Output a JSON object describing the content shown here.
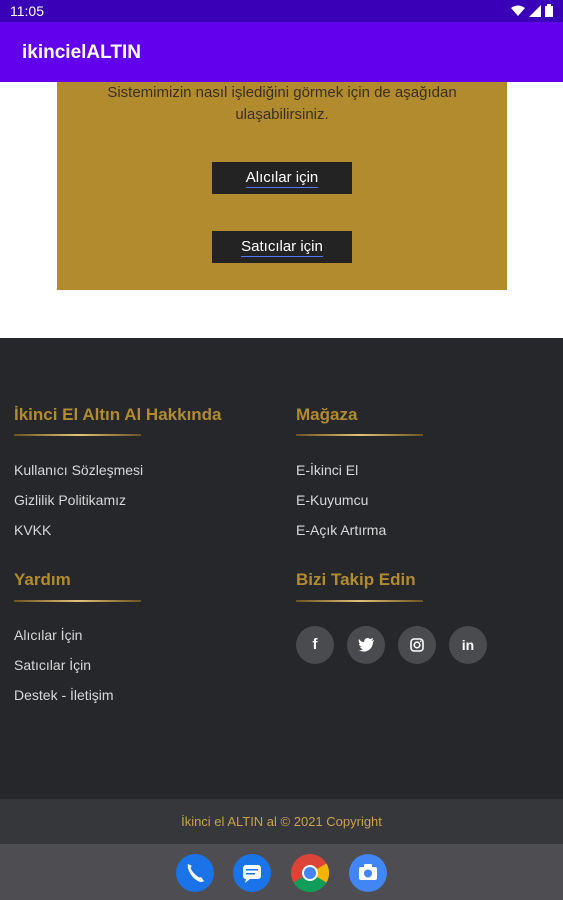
{
  "status_bar": {
    "time": "11:05"
  },
  "app_bar": {
    "title": "ikincielALTIN"
  },
  "hero": {
    "description": "Sistemimizin nasıl işlediğini görmek için de aşağıdan ulaşabilirsiniz.",
    "buyers_button": "Alıcılar için",
    "sellers_button": "Satıcılar için"
  },
  "footer": {
    "about": {
      "title": "İkinci El Altın Al Hakkında",
      "links": [
        "Kullanıcı Sözleşmesi",
        "Gizlilik Politikamız",
        "KVKK"
      ]
    },
    "store": {
      "title": "Mağaza",
      "links": [
        "E-İkinci El",
        "E-Kuyumcu",
        "E-Açık Artırma"
      ]
    },
    "help": {
      "title": "Yardım",
      "links": [
        "Alıcılar İçin",
        "Satıcılar İçin",
        "Destek - İletişim"
      ]
    },
    "follow": {
      "title": "Bizi Takip Edin",
      "icons": [
        "facebook-icon",
        "twitter-icon",
        "instagram-icon",
        "linkedin-icon"
      ]
    },
    "copyright": "İkinci el ALTIN al © 2021 Copyright"
  },
  "colors": {
    "gold": "#b38b2f",
    "dark": "#26272b",
    "purple": "#6200ee"
  }
}
